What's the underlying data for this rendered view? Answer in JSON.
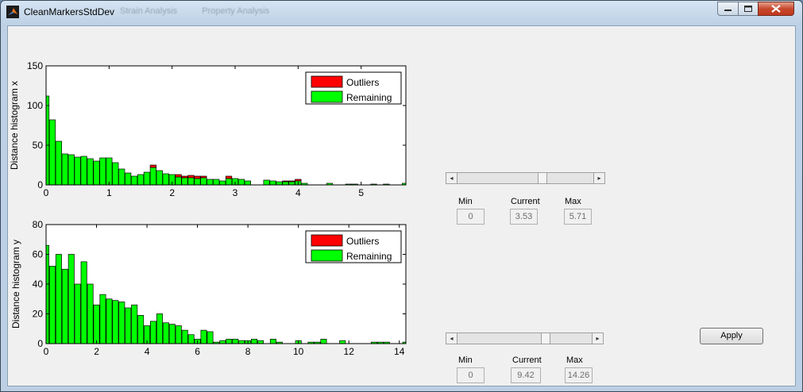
{
  "window": {
    "title": "CleanMarkersStdDev",
    "ghost_menu": [
      "Strain Analysis",
      "Property Analysis"
    ],
    "icons": {
      "app": "matlab-icon",
      "minimize": "minimize-icon",
      "maximize": "maximize-icon",
      "close": "close-icon"
    }
  },
  "colors": {
    "outliers": "#ff0000",
    "remaining": "#00ff00",
    "client_bg": "#f0f0f0"
  },
  "chart_data": [
    {
      "type": "bar",
      "stacked": true,
      "ylabel": "Distance histogram x",
      "xlim": [
        0,
        5.71
      ],
      "ylim": [
        0,
        150
      ],
      "xticks": [
        0,
        1,
        2,
        3,
        4,
        5
      ],
      "yticks": [
        0,
        50,
        100,
        150
      ],
      "legend": {
        "position": "top-right",
        "entries": [
          "Outliers",
          "Remaining"
        ]
      },
      "bin_width": 0.095,
      "x": [
        0,
        0.1,
        0.2,
        0.3,
        0.4,
        0.5,
        0.6,
        0.7,
        0.8,
        0.9,
        1.0,
        1.1,
        1.2,
        1.3,
        1.4,
        1.5,
        1.6,
        1.7,
        1.8,
        1.9,
        2.0,
        2.1,
        2.2,
        2.3,
        2.4,
        2.5,
        2.6,
        2.7,
        2.8,
        2.9,
        3.0,
        3.1,
        3.2,
        3.3,
        3.4,
        3.5,
        3.6,
        3.7,
        3.8,
        3.9,
        4.0,
        4.1,
        4.2,
        4.3,
        4.4,
        4.5,
        4.6,
        4.7,
        4.8,
        4.9,
        5.0,
        5.1,
        5.2,
        5.3,
        5.4,
        5.5,
        5.6,
        5.7
      ],
      "series": [
        {
          "name": "Remaining",
          "values": [
            112,
            82,
            55,
            39,
            38,
            35,
            36,
            33,
            30,
            34,
            34,
            28,
            20,
            15,
            11,
            13,
            16,
            22,
            18,
            14,
            13,
            10,
            9,
            9,
            8,
            9,
            7,
            7,
            5,
            8,
            8,
            7,
            5,
            0,
            0,
            6,
            5,
            4,
            4,
            4,
            5,
            2,
            0,
            0,
            0,
            2,
            0,
            0,
            1,
            1,
            0,
            0,
            1,
            0,
            1,
            0,
            0,
            2
          ]
        },
        {
          "name": "Outliers",
          "values": [
            0,
            0,
            0,
            0,
            0,
            0,
            0,
            0,
            0,
            0,
            0,
            0,
            0,
            0,
            0,
            0,
            0,
            3,
            0,
            0,
            0,
            3,
            2,
            3,
            3,
            2,
            0,
            0,
            0,
            3,
            0,
            0,
            0,
            0,
            0,
            0,
            0,
            0,
            1,
            1,
            2,
            0,
            0,
            0,
            0,
            0,
            0,
            0,
            0,
            0,
            0,
            0,
            0,
            0,
            0,
            0,
            0,
            0
          ]
        }
      ]
    },
    {
      "type": "bar",
      "stacked": true,
      "ylabel": "Distance histogram y",
      "xlim": [
        0,
        14.26
      ],
      "ylim": [
        0,
        80
      ],
      "xticks": [
        0,
        2,
        4,
        6,
        8,
        10,
        12,
        14
      ],
      "yticks": [
        0,
        20,
        40,
        60,
        80
      ],
      "legend": {
        "position": "top-right",
        "entries": [
          "Outliers",
          "Remaining"
        ]
      },
      "bin_width": 0.23,
      "x": [
        0,
        0.25,
        0.5,
        0.75,
        1.0,
        1.25,
        1.5,
        1.75,
        2.0,
        2.25,
        2.5,
        2.75,
        3.0,
        3.25,
        3.5,
        3.75,
        4.0,
        4.25,
        4.5,
        4.75,
        5.0,
        5.25,
        5.5,
        5.75,
        6.0,
        6.25,
        6.5,
        6.75,
        7.0,
        7.25,
        7.5,
        7.75,
        8.0,
        8.25,
        8.5,
        8.75,
        9.0,
        9.25,
        9.5,
        9.75,
        10.0,
        10.25,
        10.5,
        10.75,
        11.0,
        11.25,
        11.5,
        11.75,
        12.0,
        12.25,
        12.5,
        12.75,
        13.0,
        13.25,
        13.5,
        13.75,
        14.0,
        14.25
      ],
      "series": [
        {
          "name": "Remaining",
          "values": [
            66,
            52,
            60,
            50,
            60,
            40,
            55,
            40,
            26,
            33,
            30,
            29,
            28,
            24,
            26,
            19,
            12,
            15,
            20,
            14,
            13,
            12,
            9,
            6,
            3,
            9,
            8,
            1,
            2,
            3,
            3,
            2,
            2,
            3,
            2,
            0,
            3,
            1,
            0,
            0,
            2,
            0,
            1,
            1,
            3,
            0,
            0,
            2,
            0,
            0,
            0,
            0,
            1,
            1,
            1,
            0,
            0,
            1
          ]
        },
        {
          "name": "Outliers",
          "values": [
            0,
            0,
            0,
            0,
            0,
            0,
            0,
            0,
            0,
            0,
            0,
            0,
            0,
            0,
            0,
            0,
            0,
            0,
            0,
            0,
            0,
            0,
            0,
            0,
            0,
            0,
            0,
            0,
            0,
            0,
            0,
            0,
            0,
            0,
            0,
            0,
            0,
            0,
            0,
            0,
            0,
            0,
            0,
            0,
            0,
            0,
            0,
            0,
            0,
            0,
            0,
            0,
            0,
            0,
            0,
            0,
            0,
            0
          ]
        }
      ]
    }
  ],
  "controls": {
    "x": {
      "min_label": "Min",
      "current_label": "Current",
      "max_label": "Max",
      "min": "0",
      "current": "3.53",
      "max": "5.71",
      "value": 3.53,
      "range": [
        0,
        5.71
      ]
    },
    "y": {
      "min_label": "Min",
      "current_label": "Current",
      "max_label": "Max",
      "min": "0",
      "current": "9.42",
      "max": "14.26",
      "value": 9.42,
      "range": [
        0,
        14.26
      ]
    },
    "apply_label": "Apply"
  }
}
